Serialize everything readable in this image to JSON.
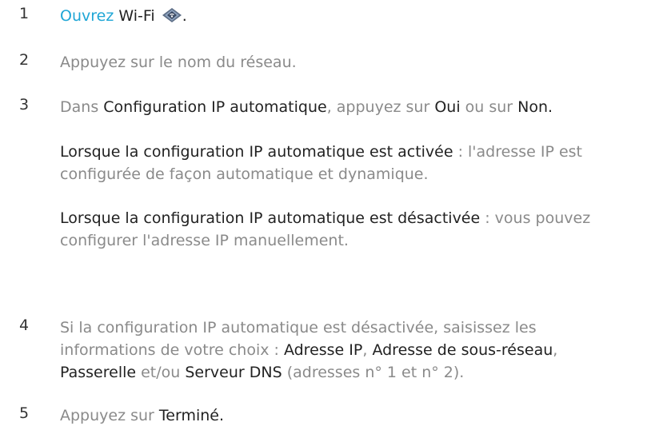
{
  "steps": [
    {
      "number": "1",
      "link": "Ouvrez",
      "label": "Wi-Fi",
      "icon": "wifi-settings-icon",
      "end": "."
    },
    {
      "number": "2",
      "text": "Appuyez sur le nom du réseau."
    },
    {
      "number": "3",
      "t1": "Dans ",
      "b1": "Configuration IP automatique",
      "t2": ", appuyez sur ",
      "b2": "Oui",
      "t3": " ou sur ",
      "b3": "Non",
      "t4": "."
    },
    {
      "number": "4",
      "line1": "Si la configuration IP automatique est désactivée, saisissez les",
      "line2_t1": "informations de votre choix : ",
      "line2_b1": "Adresse IP",
      "line2_t2": ", ",
      "line2_b2": "Adresse de sous-réseau",
      "line2_t3": ",",
      "line3_b1": "Passerelle",
      "line3_t1": " et/ou ",
      "line3_b2": "Serveur DNS",
      "line3_t2": " (adresses n° 1 et n° 2)."
    },
    {
      "number": "5",
      "t1": "Appuyez sur ",
      "b1": "Terminé",
      "t2": "."
    }
  ],
  "notes": [
    {
      "bold": "Lorsque la configuration IP automatique est activée",
      "rest1": " : l'adresse IP est",
      "line2": "configurée de façon automatique et dynamique."
    },
    {
      "bold": "Lorsque la configuration IP automatique est désactivée",
      "rest1": " : vous pouvez",
      "line2": "configurer l'adresse IP manuellement."
    }
  ],
  "colors": {
    "link": "#1fa6d6",
    "emphasis": "#222222",
    "body": "#8a8a8a"
  }
}
